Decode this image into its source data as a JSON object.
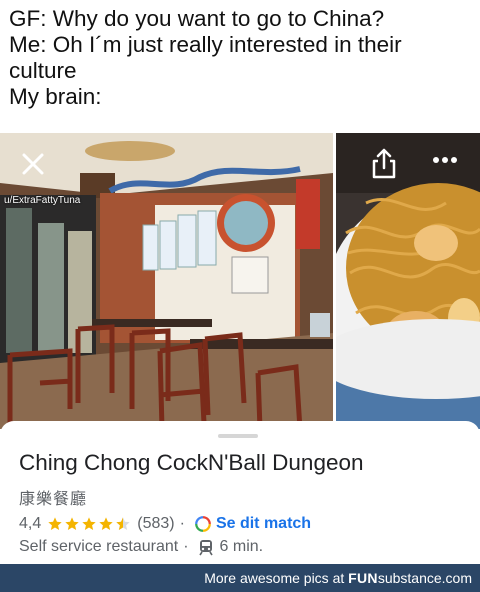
{
  "caption": {
    "line1": "GF: Why do you want to go to China?",
    "line2": "Me: Oh I´m just really interested in their culture",
    "line3": "My brain:"
  },
  "photo": {
    "username": "u/ExtraFattyTuna",
    "icons": [
      "close-icon",
      "share-icon",
      "more-icon"
    ]
  },
  "place": {
    "name": "Ching Chong CockN'Ball Dungeon",
    "native_name": "康樂餐廳",
    "rating": "4,4",
    "stars": 4.5,
    "review_count": "(583)",
    "match_label": "Se dit match",
    "type": "Self service restaurant",
    "travel_time": "6 min.",
    "colors": {
      "star": "#f4b400",
      "match": "#1a73e8"
    }
  },
  "footer": {
    "prefix": "More awesome pics at",
    "brand_bold": "FUN",
    "brand_rest": "substance",
    "domain": ".com"
  }
}
